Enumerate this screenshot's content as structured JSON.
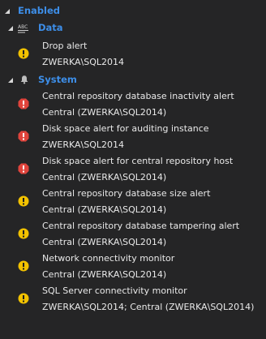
{
  "tree": {
    "enabled_label": "Enabled",
    "groups": [
      {
        "label": "Data",
        "icon": "abc-text-icon",
        "items": [
          {
            "title": "Drop alert",
            "target": "ZWERKA\\SQL2014",
            "severity": "warning"
          }
        ]
      },
      {
        "label": "System",
        "icon": "bell-icon",
        "items": [
          {
            "title": "Central repository database inactivity alert",
            "target": "Central (ZWERKA\\SQL2014)",
            "severity": "error"
          },
          {
            "title": "Disk space alert for auditing instance",
            "target": "ZWERKA\\SQL2014",
            "severity": "error"
          },
          {
            "title": "Disk space alert for central repository host",
            "target": "Central (ZWERKA\\SQL2014)",
            "severity": "error"
          },
          {
            "title": "Central repository database size alert",
            "target": "Central (ZWERKA\\SQL2014)",
            "severity": "warning"
          },
          {
            "title": "Central repository database tampering alert",
            "target": "Central (ZWERKA\\SQL2014)",
            "severity": "warning"
          },
          {
            "title": "Network connectivity monitor",
            "target": "Central (ZWERKA\\SQL2014)",
            "severity": "warning"
          },
          {
            "title": "SQL Server connectivity monitor",
            "target": "ZWERKA\\SQL2014; Central (ZWERKA\\SQL2014)",
            "severity": "warning"
          }
        ]
      }
    ]
  },
  "colors": {
    "background": "#252526",
    "group_label": "#3d8ee8",
    "warning": "#f2c200",
    "error": "#e0443c"
  }
}
